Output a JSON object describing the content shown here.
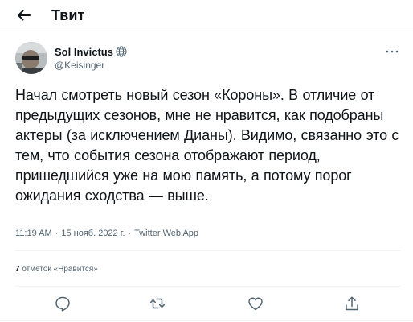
{
  "header": {
    "title": "Твит",
    "back_icon": "arrow-left-icon"
  },
  "tweet": {
    "author_name": "Sol Invictus",
    "author_handle": "@Keisinger",
    "verified_icon": "globe-icon",
    "more_icon": "more-dots-icon",
    "text": "Начал смотреть новый сезон «Короны». В отличие от предыдущих сезонов, мне не нравится, как подобраны актеры (за исключением Дианы). Видимо, связанно это с тем, что события сезона отображают период, пришедшийся уже на мою память, а потому порог ожидания сходства — выше.",
    "time": "11:19 AM",
    "separator": "·",
    "date": "15 нояб. 2022 г.",
    "client": "Twitter Web App",
    "likes_count": "7",
    "likes_label": "отметок «Нравится»"
  },
  "actions": {
    "reply_icon": "reply-icon",
    "retweet_icon": "retweet-icon",
    "like_icon": "heart-icon",
    "share_icon": "share-icon"
  },
  "colors": {
    "text": "#0f1419",
    "secondary": "#536471",
    "divider": "#eff3f4"
  }
}
